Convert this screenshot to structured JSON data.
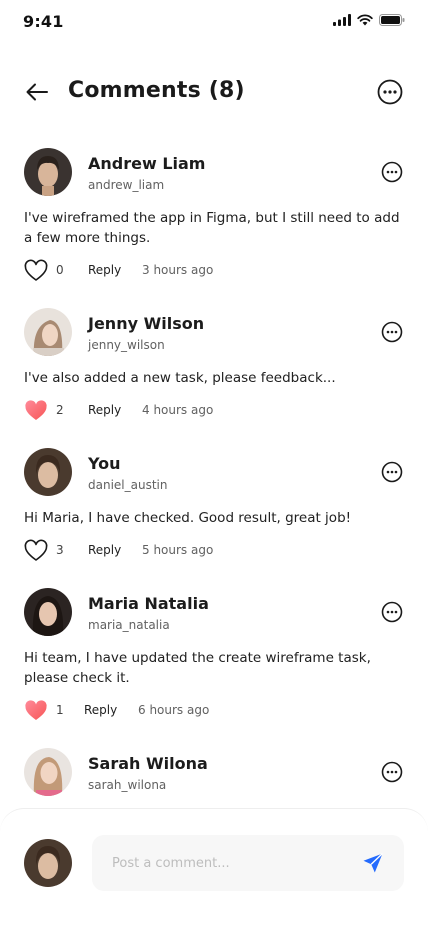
{
  "status_bar": {
    "time": "9:41"
  },
  "header": {
    "title": "Comments (8)"
  },
  "comments": [
    {
      "name": "Andrew Liam",
      "handle": "andrew_liam",
      "text": "I've wireframed the app in Figma, but I still need to add a few more things.",
      "likes": "0",
      "liked": false,
      "reply_label": "Reply",
      "time": "3 hours ago"
    },
    {
      "name": "Jenny Wilson",
      "handle": "jenny_wilson",
      "text": "I've also added a new task, please feedback...",
      "likes": "2",
      "liked": true,
      "reply_label": "Reply",
      "time": "4 hours ago"
    },
    {
      "name": "You",
      "handle": "daniel_austin",
      "text": "Hi Maria, I have checked. Good result, great job!",
      "likes": "3",
      "liked": false,
      "reply_label": "Reply",
      "time": "5 hours ago"
    },
    {
      "name": "Maria Natalia",
      "handle": "maria_natalia",
      "text": "Hi team, I have updated the create wireframe task, please check it.",
      "likes": "1",
      "liked": true,
      "reply_label": "Reply",
      "time": "6 hours ago"
    },
    {
      "name": "Sarah Wilona",
      "handle": "sarah_wilona"
    }
  ],
  "composer": {
    "placeholder": "Post a comment..."
  },
  "colors": {
    "accent": "#246BFD",
    "liked": "#F75555"
  }
}
